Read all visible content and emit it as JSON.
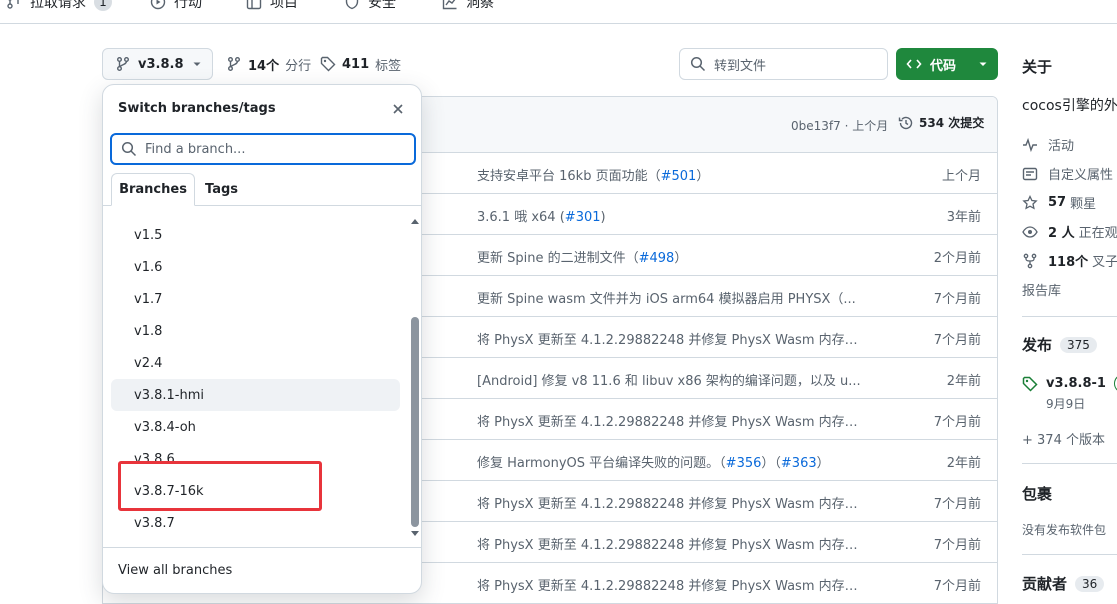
{
  "nav": {
    "items": [
      {
        "label": "拉取请求",
        "badge": "1"
      },
      {
        "label": "行动"
      },
      {
        "label": "项目"
      },
      {
        "label": "安全"
      },
      {
        "label": "洞察"
      }
    ]
  },
  "toolbar": {
    "branch": "v3.8.8",
    "branches_count": "14个",
    "branches_label": "分行",
    "tags_count": "411",
    "tags_label": "标签",
    "goto_file": "转到文件",
    "code_button": "代码"
  },
  "files": {
    "last_commit_sha": "0be13f7 · 上个月",
    "commits_count": "534 次提交",
    "rows": [
      {
        "pre": "支持安卓平台 16kb 页面功能（",
        "link": "#501",
        "post": "）",
        "date": "上个月"
      },
      {
        "pre": "3.6.1 哦 x64 (",
        "link": "#301",
        "post": ")",
        "date": "3年前"
      },
      {
        "pre": "更新 Spine 的二进制文件（",
        "link": "#498",
        "post": "）",
        "date": "2个月前"
      },
      {
        "pre": "更新 Spine wasm 文件并为 iOS arm64 模拟器启用 PHYSX（...",
        "link": "",
        "post": "",
        "date": "7个月前"
      },
      {
        "pre": "将 PhysX 更新至 4.1.2.29882248 并修复 PhysX Wasm 内存泄...",
        "link": "",
        "post": "",
        "date": "7个月前"
      },
      {
        "pre": "[Android] 修复 v8 11.6 和 libuv x86 架构的编译问题，以及 u...",
        "link": "",
        "post": "",
        "date": "2年前"
      },
      {
        "pre": "将 PhysX 更新至 4.1.2.29882248 并修复 PhysX Wasm 内存泄...",
        "link": "",
        "post": "",
        "date": "7个月前"
      },
      {
        "pre": "修复 HarmonyOS 平台编译失败的问题。（",
        "link": "#356",
        "post": "）（",
        "link2": "#363",
        "post2": "）",
        "date": "2年前"
      },
      {
        "pre": "将 PhysX 更新至 4.1.2.29882248 并修复 PhysX Wasm 内存泄...",
        "link": "",
        "post": "",
        "date": "7个月前"
      },
      {
        "pre": "将 PhysX 更新至 4.1.2.29882248 并修复 PhysX Wasm 内存泄...",
        "link": "",
        "post": "",
        "date": "7个月前"
      },
      {
        "pre": "将 PhysX 更新至 4.1.2.29882248 并修复 PhysX Wasm 内存泄...",
        "link": "",
        "post": "",
        "date": "7个月前"
      }
    ]
  },
  "sidebar": {
    "about_title": "关于",
    "description": "cocos引擎的外",
    "activity": "活动",
    "custom_props": "自定义属性",
    "stars_count": "57",
    "stars_label": "颗星",
    "watching_count": "2 人",
    "watching_label": "正在观",
    "forks_count": "118个",
    "forks_label": "叉子",
    "report": "报告库",
    "releases_title": "发布",
    "releases_count": "375",
    "latest_release": "v3.8.8-1",
    "latest_badge": "最",
    "release_date": "9月9日",
    "more_versions": "+ 374 个版本",
    "packages_title": "包裹",
    "no_packages": "没有发布软件包",
    "contributors_title": "贡献者",
    "contributors_count": "36"
  },
  "popover": {
    "title": "Switch branches/tags",
    "search_placeholder": "Find a branch...",
    "tab_branches": "Branches",
    "tab_tags": "Tags",
    "branches": [
      "v1.5",
      "v1.6",
      "v1.7",
      "v1.8",
      "v2.4",
      "v3.8.1-hmi",
      "v3.8.4-oh",
      "v3.8.6",
      "v3.8.7-16k",
      "v3.8.7"
    ],
    "view_all": "View all branches"
  },
  "colors": {
    "accent": "#0969da",
    "code_button": "#1f883d",
    "highlight_box": "#e8343b"
  }
}
